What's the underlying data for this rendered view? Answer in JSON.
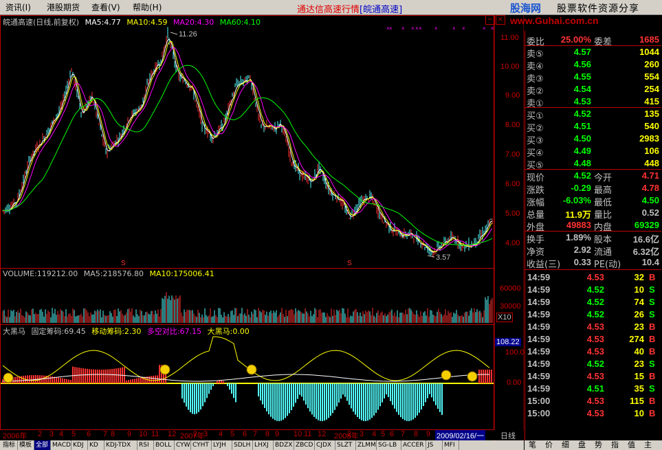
{
  "menu": [
    "资讯(I)",
    "港股期货",
    "查看(V)",
    "帮助(H)"
  ],
  "app_title": "通达信高速行情",
  "app_subtitle": "[皖通高速]",
  "brand": {
    "logo": "股海网",
    "slogan": "股票软件资源分享",
    "url": "www.Guhai.com.cn"
  },
  "main_pane": {
    "title": "皖通高速(日线,前复权)",
    "ma5": "MA5:4.77",
    "ma10": "MA10:4.59",
    "ma20": "MA20:4.30",
    "ma60": "MA60:4.10",
    "high_marker": "11.26",
    "low_marker": "3.57",
    "y_labels": [
      "11.00",
      "10.00",
      "9.00",
      "8.00",
      "7.00",
      "6.00",
      "5.00",
      "4.00"
    ]
  },
  "volume_pane": {
    "volume": "VOLUME:119212.00",
    "ma5": "MA5:218576.80",
    "ma10": "MA10:175006.41",
    "y_labels": [
      "60000",
      "30000"
    ],
    "multiplier": "X10"
  },
  "indicator_pane": {
    "name": "大黑马",
    "fixed": "固定筹码:69.45",
    "moving": "移动筹码:2.30",
    "ratio": "多空对比:67.15",
    "horse": "大黑马:0.00",
    "current_value": "108.22",
    "y_labels": [
      "100.0",
      "0.00"
    ]
  },
  "date_axis": {
    "ticks": [
      "2006年",
      "2",
      "3",
      "4",
      "5",
      "6",
      "7",
      "8",
      "9",
      "10",
      "11",
      "12",
      "2007年",
      "2",
      "3",
      "4",
      "5",
      "6",
      "7",
      "8",
      "9",
      "10",
      "11",
      "12",
      "2008年",
      "2",
      "3",
      "4",
      "5",
      "6",
      "7",
      "8",
      "9",
      "10",
      "11"
    ],
    "cursor_date": "2009/02/16/一",
    "period": "日线"
  },
  "indicator_tabs": [
    "指标",
    "模板",
    "全部",
    "MACD",
    "KDJ",
    "KD",
    "KDJ-TDX",
    "RSI",
    "BOLL",
    "CYW",
    "CYHT",
    "LYJH",
    "SDLH",
    "LHXJ",
    "BDZX",
    "ZBCD",
    "CJDX",
    "SLZT",
    "ZLMM",
    "SG-LB",
    "ACCER",
    "JS",
    "MFI"
  ],
  "quote": {
    "wei_bi_label": "委比",
    "wei_bi": "25.00%",
    "wei_cha_label": "委差",
    "wei_cha": "1685",
    "asks": [
      {
        "label": "卖⑤",
        "price": "4.57",
        "vol": "1044"
      },
      {
        "label": "卖④",
        "price": "4.56",
        "vol": "260"
      },
      {
        "label": "卖③",
        "price": "4.55",
        "vol": "554"
      },
      {
        "label": "卖②",
        "price": "4.54",
        "vol": "254"
      },
      {
        "label": "卖①",
        "price": "4.53",
        "vol": "415"
      }
    ],
    "bids": [
      {
        "label": "买①",
        "price": "4.52",
        "vol": "135"
      },
      {
        "label": "买②",
        "price": "4.51",
        "vol": "540"
      },
      {
        "label": "买③",
        "price": "4.50",
        "vol": "2983"
      },
      {
        "label": "买④",
        "price": "4.49",
        "vol": "106"
      },
      {
        "label": "买⑤",
        "price": "4.48",
        "vol": "448"
      }
    ],
    "stats": [
      {
        "l1": "现价",
        "v1": "4.52",
        "c1": "green",
        "l2": "今开",
        "v2": "4.71",
        "c2": "red"
      },
      {
        "l1": "涨跌",
        "v1": "-0.29",
        "c1": "green",
        "l2": "最高",
        "v2": "4.78",
        "c2": "red"
      },
      {
        "l1": "涨幅",
        "v1": "-6.03%",
        "c1": "green",
        "l2": "最低",
        "v2": "4.50",
        "c2": "green"
      },
      {
        "l1": "总量",
        "v1": "11.9万",
        "c1": "yellow",
        "l2": "量比",
        "v2": "0.52",
        "c2": "white"
      },
      {
        "l1": "外盘",
        "v1": "49883",
        "c1": "red",
        "l2": "内盘",
        "v2": "69329",
        "c2": "green"
      }
    ],
    "fundamentals": [
      {
        "l1": "换手",
        "v1": "1.89%",
        "l2": "股本",
        "v2": "16.6亿"
      },
      {
        "l1": "净资",
        "v1": "2.92",
        "l2": "流通",
        "v2": "6.32亿"
      },
      {
        "l1": "收益(三)",
        "v1": "0.33",
        "l2": "PE(动)",
        "v2": "10.4"
      }
    ]
  },
  "ticks": [
    {
      "time": "14:59",
      "price": "4.53",
      "vol": "32",
      "side": "B"
    },
    {
      "time": "14:59",
      "price": "4.52",
      "vol": "10",
      "side": "S"
    },
    {
      "time": "14:59",
      "price": "4.52",
      "vol": "74",
      "side": "S"
    },
    {
      "time": "14:59",
      "price": "4.52",
      "vol": "26",
      "side": "S"
    },
    {
      "time": "14:59",
      "price": "4.53",
      "vol": "23",
      "side": "B"
    },
    {
      "time": "14:59",
      "price": "4.53",
      "vol": "274",
      "side": "B"
    },
    {
      "time": "14:59",
      "price": "4.53",
      "vol": "40",
      "side": "B"
    },
    {
      "time": "14:59",
      "price": "4.52",
      "vol": "23",
      "side": "S"
    },
    {
      "time": "14:59",
      "price": "4.53",
      "vol": "15",
      "side": "B"
    },
    {
      "time": "14:59",
      "price": "4.51",
      "vol": "35",
      "side": "S"
    },
    {
      "time": "15:00",
      "price": "4.53",
      "vol": "115",
      "side": "B"
    },
    {
      "time": "15:00",
      "price": "4.53",
      "vol": "10",
      "side": "B"
    }
  ],
  "side_tabs": [
    "笔",
    "价",
    "细",
    "盘",
    "势",
    "指",
    "值",
    "主"
  ],
  "colors": {
    "up": "#ff3232",
    "down": "#54fcfc",
    "ma5": "#ffffff",
    "ma10": "#ffff00",
    "ma20": "#ff00ff",
    "ma60": "#00ff00",
    "frame": "#c00000"
  }
}
